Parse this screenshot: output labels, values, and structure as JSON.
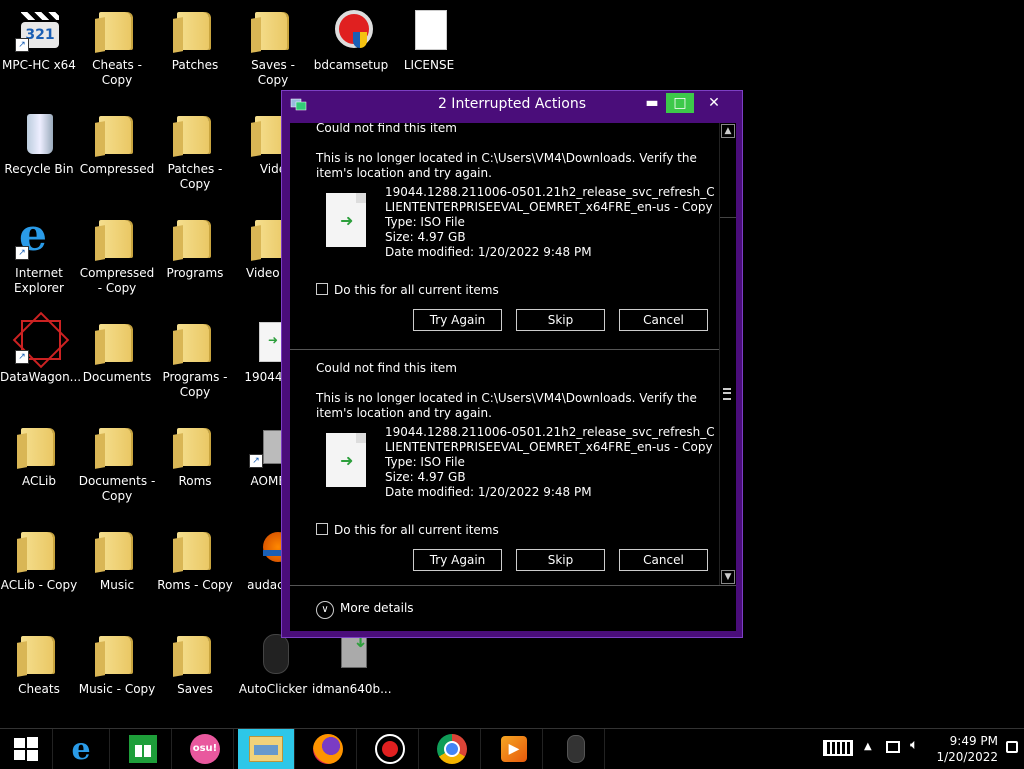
{
  "desktop": {
    "icons": [
      {
        "label": "MPC-HC x64",
        "type": "app"
      },
      {
        "label": "Cheats - Copy",
        "type": "folder"
      },
      {
        "label": "Patches",
        "type": "folder"
      },
      {
        "label": "Saves - Copy",
        "type": "folder"
      },
      {
        "label": "bdcamsetup",
        "type": "app"
      },
      {
        "label": "LICENSE",
        "type": "file"
      },
      {
        "label": "Recycle Bin",
        "type": "bin"
      },
      {
        "label": "Compressed",
        "type": "folder"
      },
      {
        "label": "Patches - Copy",
        "type": "folder"
      },
      {
        "label": "Vide",
        "type": "folder"
      },
      {
        "label": "Internet Explorer",
        "type": "app"
      },
      {
        "label": "Compressed - Copy",
        "type": "folder"
      },
      {
        "label": "Programs",
        "type": "folder"
      },
      {
        "label": "Video - C",
        "type": "folder"
      },
      {
        "label": "DataWagon...",
        "type": "app"
      },
      {
        "label": "Documents",
        "type": "folder"
      },
      {
        "label": "Programs - Copy",
        "type": "folder"
      },
      {
        "label": "19044.12",
        "type": "file"
      },
      {
        "label": "ACLib",
        "type": "folder"
      },
      {
        "label": "Documents - Copy",
        "type": "folder"
      },
      {
        "label": "Roms",
        "type": "folder"
      },
      {
        "label": "AOMEI_",
        "type": "app"
      },
      {
        "label": "ACLib - Copy",
        "type": "folder"
      },
      {
        "label": "Music",
        "type": "folder"
      },
      {
        "label": "Roms - Copy",
        "type": "folder"
      },
      {
        "label": "audacity",
        "type": "app"
      },
      {
        "label": "Cheats",
        "type": "folder"
      },
      {
        "label": "Music - Copy",
        "type": "folder"
      },
      {
        "label": "Saves",
        "type": "folder"
      },
      {
        "label": "AutoClicker",
        "type": "app"
      },
      {
        "label": "idman640b...",
        "type": "app"
      }
    ]
  },
  "dialog": {
    "title": "2 Interrupted Actions",
    "items": [
      {
        "heading": "Could not find this item",
        "message": "This is no longer located in C:\\Users\\VM4\\Downloads. Verify the item's location and try again.",
        "filename": "19044.1288.211006-0501.21h2_release_svc_refresh_CLIENTENTERPRISEEVAL_OEMRET_x64FRE_en-us - Copy",
        "type": "Type: ISO File",
        "size": "Size: 4.97 GB",
        "modified": "Date modified: 1/20/2022 9:48 PM",
        "checkbox_label": "Do this for all current items",
        "try_again": "Try Again",
        "skip": "Skip",
        "cancel": "Cancel"
      },
      {
        "heading": "Could not find this item",
        "message": "This is no longer located in C:\\Users\\VM4\\Downloads. Verify the item's location and try again.",
        "filename": "19044.1288.211006-0501.21h2_release_svc_refresh_CLIENTENTERPRISEEVAL_OEMRET_x64FRE_en-us - Copy",
        "type": "Type: ISO File",
        "size": "Size: 4.97 GB",
        "modified": "Date modified: 1/20/2022 9:48 PM",
        "checkbox_label": "Do this for all current items",
        "try_again": "Try Again",
        "skip": "Skip",
        "cancel": "Cancel"
      }
    ],
    "more_details": "More details"
  },
  "taskbar": {
    "apps": [
      "start",
      "internet-explorer",
      "store",
      "osu",
      "file-explorer",
      "firefox",
      "bandicam",
      "chrome",
      "media-player",
      "autoclicker"
    ],
    "osu_label": "osu!",
    "time": "9:49 PM",
    "date": "1/20/2022"
  },
  "colors": {
    "dialog_frame": "#4a0d7a",
    "maximize_btn": "#3dc94a",
    "active_task": "#2dc7e8"
  }
}
